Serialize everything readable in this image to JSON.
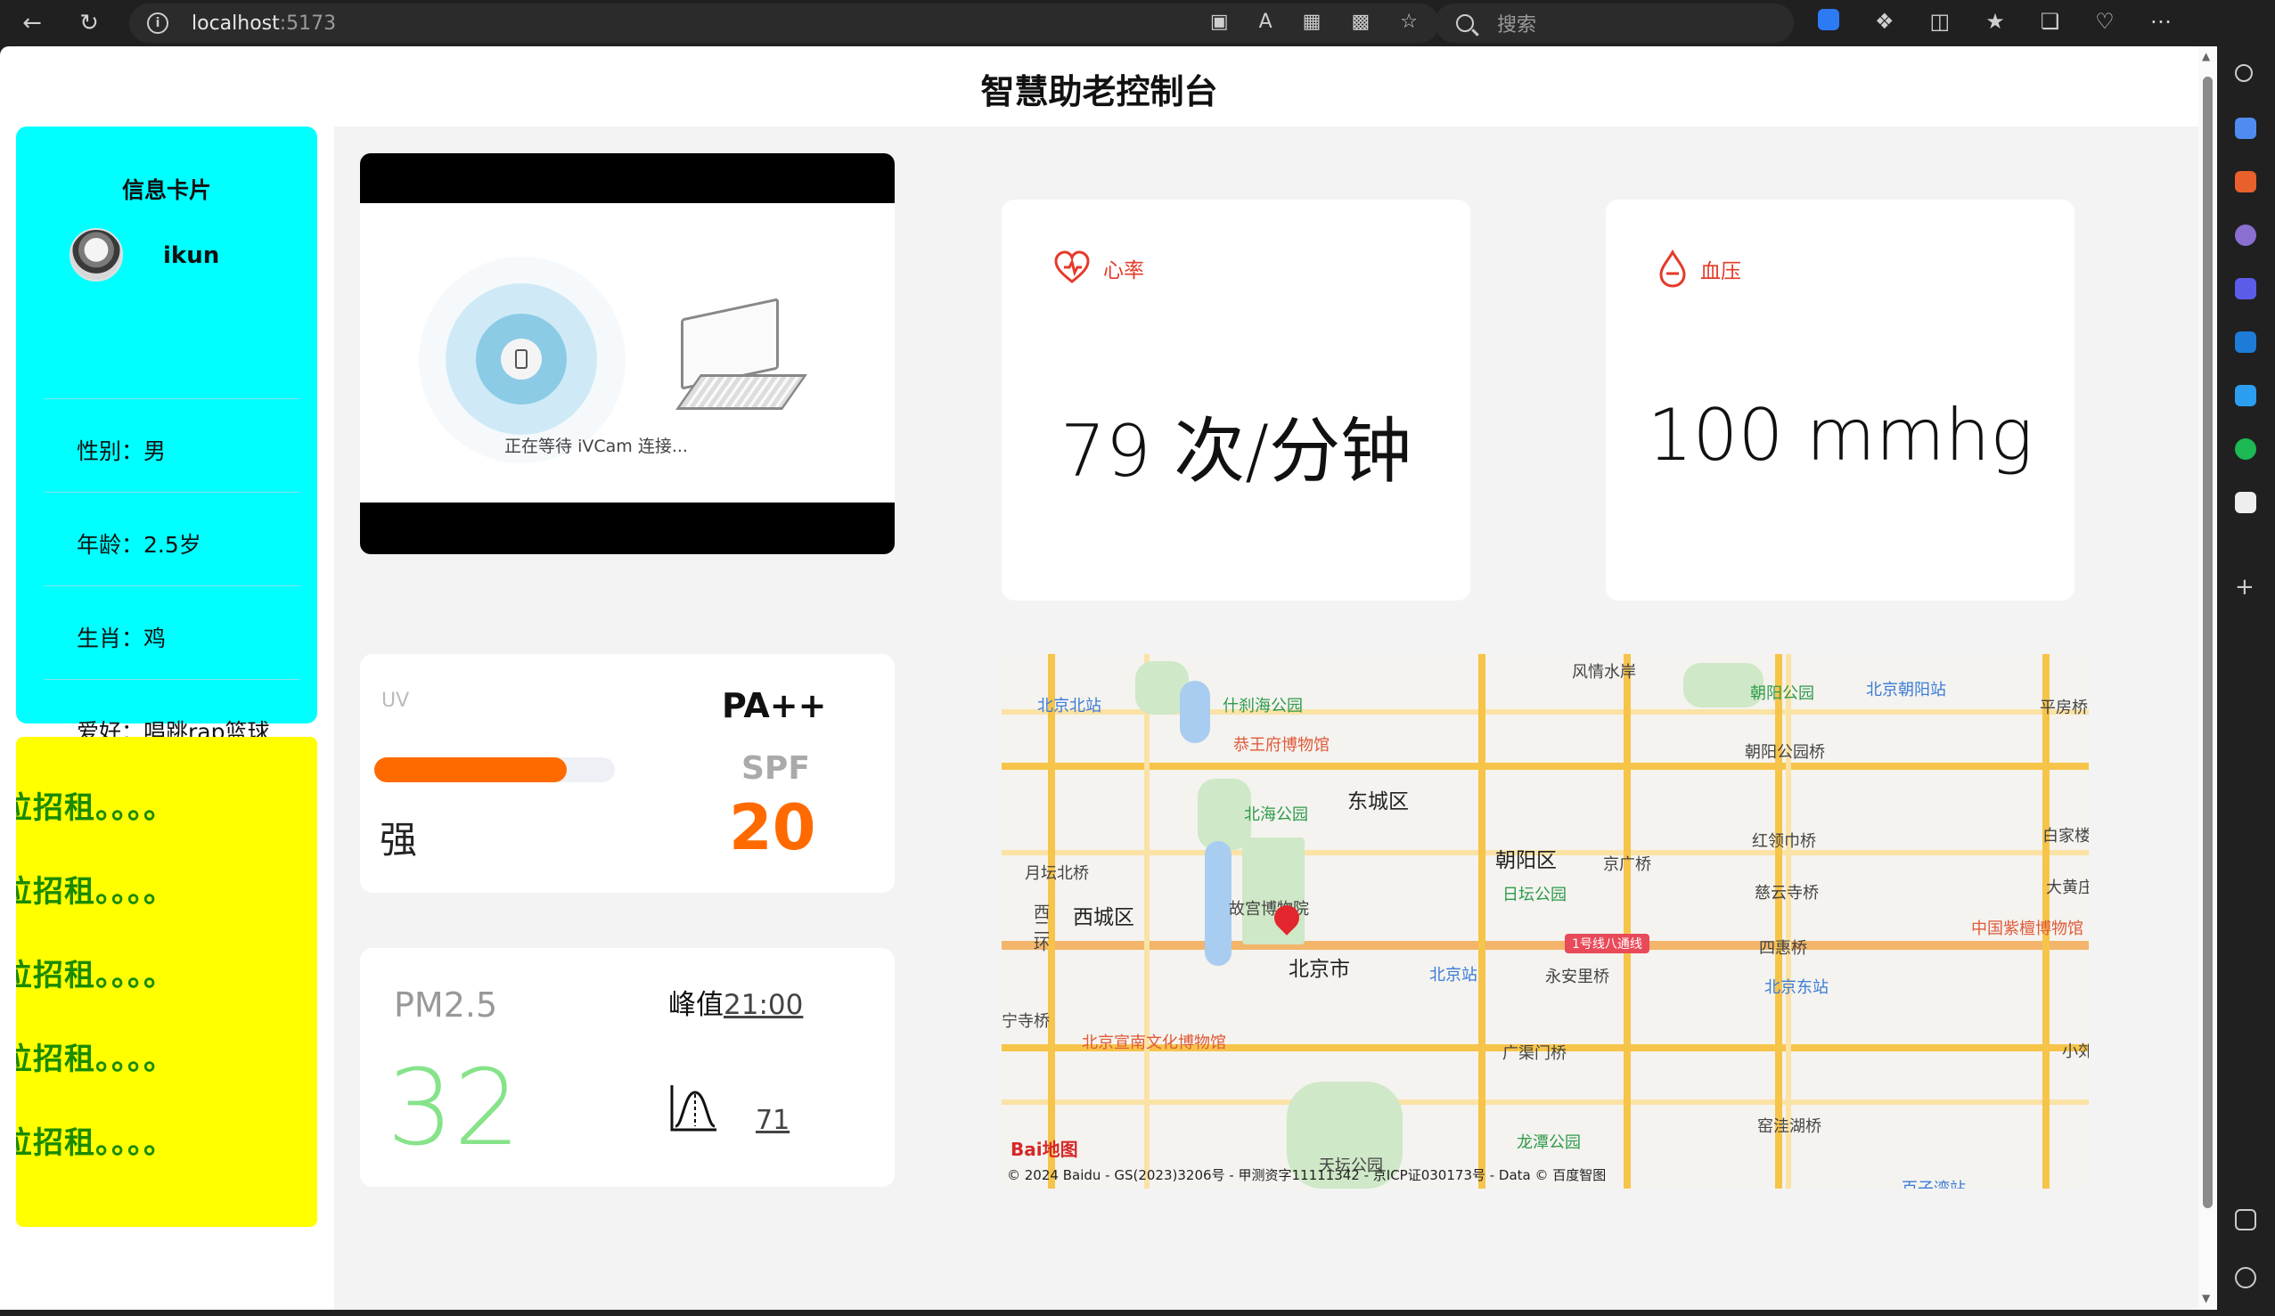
{
  "browser": {
    "host": "localhost",
    "port": ":5173",
    "search_placeholder": "搜索"
  },
  "page": {
    "title": "智慧助老控制台"
  },
  "info_card": {
    "title": "信息卡片",
    "username": "ikun",
    "rows": [
      "性别：男",
      "年龄：2.5岁",
      "生肖：鸡",
      "爱好：唱跳rap篮球"
    ]
  },
  "ad_card": {
    "lines": [
      "位招租。。。。",
      "位招租。。。。",
      "位招租。。。。",
      "位招租。。。。",
      "位招租。。。。"
    ]
  },
  "camera": {
    "caption": "正在等待 iVCam 连接..."
  },
  "heart_rate": {
    "label": "心率",
    "value": "79 次/分钟"
  },
  "blood_pressure": {
    "label": "血压",
    "value": "100 mmhg"
  },
  "uv": {
    "label": "UV",
    "level_fraction": 0.8,
    "strength": "强",
    "pa": "PA++",
    "spf_label": "SPF",
    "spf_value": "20"
  },
  "pm25": {
    "label": "PM2.5",
    "value": "32",
    "peak_label": "峰值",
    "peak_time": "21:00",
    "peak_value": "71"
  },
  "map": {
    "labels": {
      "dongcheng": "东城区",
      "xicheng": "西城区",
      "chaoyang": "朝阳区",
      "beijing": "北京市",
      "gugong": "故宫博物院",
      "beihai": "北海公园",
      "shichahai": "什刹海公园",
      "gongwangfu": "恭王府博物馆",
      "ritan": "日坛公园",
      "chaoyang_park": "朝阳公园",
      "tiantan": "天坛公园",
      "longtan": "龙潭公园",
      "beijing_north": "北京北站",
      "beijing_station": "北京站",
      "beijing_east": "北京东站",
      "chaoyang_station": "北京朝阳站",
      "xuannan": "北京宣南文化博物馆",
      "zitan": "中国紫檀博物馆",
      "yuetanbei": "月坛北桥",
      "jingguang": "京广桥",
      "hongling": "红领巾桥",
      "ciyun": "慈云寺桥",
      "sihui": "四惠桥",
      "yonganli": "永安里桥",
      "guangqumen": "广渠门桥",
      "fengqing": "风情水岸",
      "pingfang": "平房桥",
      "chaoyang_gongyuan_qiao": "朝阳公园桥",
      "baijia": "白家楼桥",
      "dahuang": "大黄庄桥",
      "xiaojiao": "小郊",
      "yaowa": "窑洼湖桥",
      "xizhimen": "西二环",
      "baozisi": "宁寺桥",
      "metro_line": "1号线八通线",
      "baizi": "百子湾站"
    },
    "logo": "Bai地图",
    "copyright": "© 2024 Baidu - GS(2023)3206号 - 甲测资字11111342 - 京ICP证030173号 - Data © 百度智图"
  },
  "colors": {
    "accent_orange": "#ff6a00",
    "info_card_bg": "#00ffff",
    "ad_card_bg": "#ffff00",
    "ad_text": "#1a8a00",
    "vital_red": "#e53a2a",
    "pm_green": "#86e38a"
  }
}
